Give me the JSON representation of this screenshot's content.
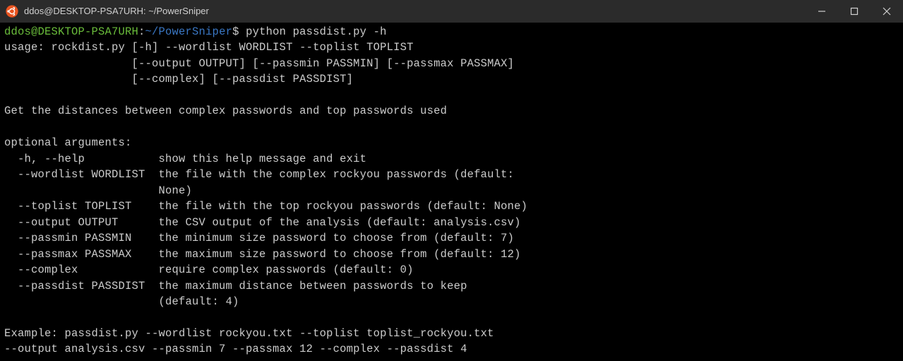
{
  "titlebar": {
    "title": "ddos@DESKTOP-PSA7URH: ~/PowerSniper"
  },
  "prompt": {
    "user_host": "ddos@DESKTOP-PSA7URH",
    "colon": ":",
    "path": "~/PowerSniper",
    "dollar": "$",
    "command": " python passdist.py -h"
  },
  "output": {
    "line1": "usage: rockdist.py [-h] --wordlist WORDLIST --toplist TOPLIST",
    "line2": "                   [--output OUTPUT] [--passmin PASSMIN] [--passmax PASSMAX]",
    "line3": "                   [--complex] [--passdist PASSDIST]",
    "line4": "",
    "line5": "Get the distances between complex passwords and top passwords used",
    "line6": "",
    "line7": "optional arguments:",
    "line8": "  -h, --help           show this help message and exit",
    "line9": "  --wordlist WORDLIST  the file with the complex rockyou passwords (default:",
    "line10": "                       None)",
    "line11": "  --toplist TOPLIST    the file with the top rockyou passwords (default: None)",
    "line12": "  --output OUTPUT      the CSV output of the analysis (default: analysis.csv)",
    "line13": "  --passmin PASSMIN    the minimum size password to choose from (default: 7)",
    "line14": "  --passmax PASSMAX    the maximum size password to choose from (default: 12)",
    "line15": "  --complex            require complex passwords (default: 0)",
    "line16": "  --passdist PASSDIST  the maximum distance between passwords to keep",
    "line17": "                       (default: 4)",
    "line18": "",
    "line19": "Example: passdist.py --wordlist rockyou.txt --toplist toplist_rockyou.txt",
    "line20": "--output analysis.csv --passmin 7 --passmax 12 --complex --passdist 4"
  }
}
